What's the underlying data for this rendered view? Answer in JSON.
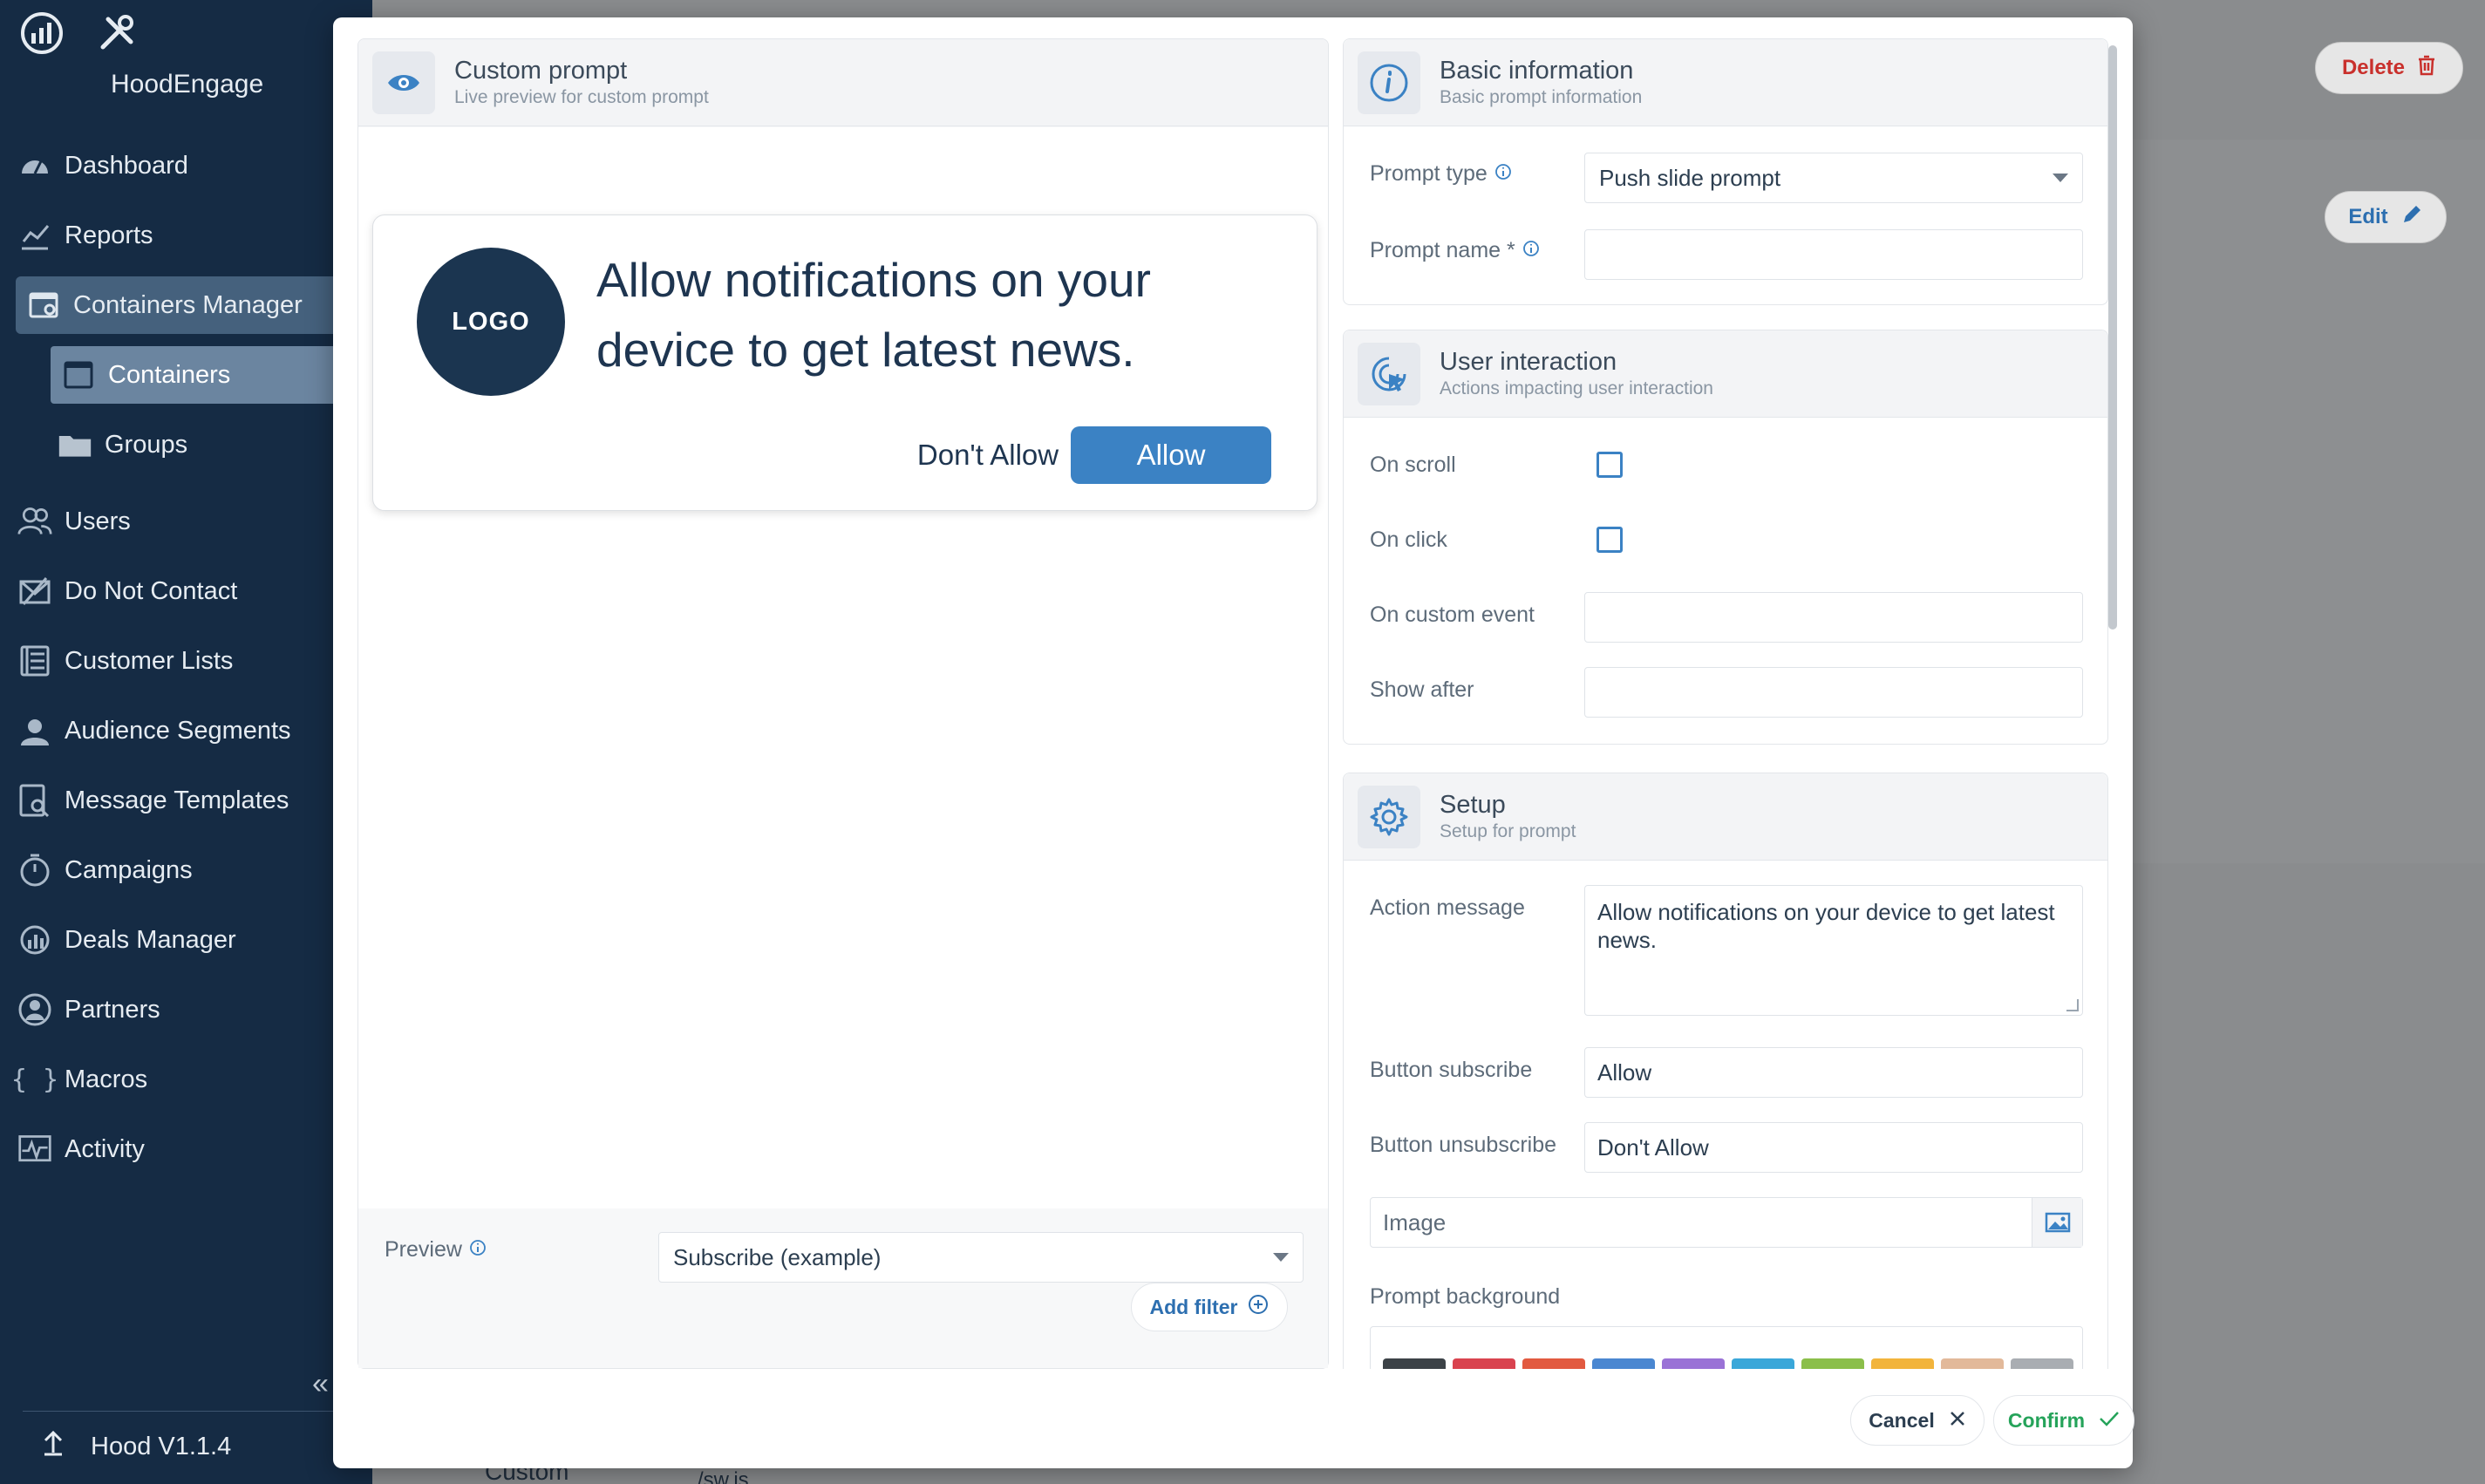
{
  "sidebar": {
    "brand": "HoodEngage",
    "items": [
      {
        "label": "Dashboard"
      },
      {
        "label": "Reports"
      },
      {
        "label": "Containers Manager"
      },
      {
        "label": "Containers"
      },
      {
        "label": "Groups"
      },
      {
        "label": "Users"
      },
      {
        "label": "Do Not Contact"
      },
      {
        "label": "Customer Lists"
      },
      {
        "label": "Audience Segments"
      },
      {
        "label": "Message Templates"
      },
      {
        "label": "Campaigns"
      },
      {
        "label": "Deals Manager"
      },
      {
        "label": "Partners"
      },
      {
        "label": "Macros"
      },
      {
        "label": "Activity"
      }
    ],
    "collapse": "«",
    "version": "Hood V1.1.4"
  },
  "background": {
    "delete_label": "Delete",
    "edit_label": "Edit",
    "footer_text": "Custom",
    "footer_text2": "/sw.js"
  },
  "custom_prompt": {
    "title": "Custom prompt",
    "subtitle": "Live preview for custom prompt",
    "logo": "LOGO",
    "message": "Allow notifications on your device to get latest news.",
    "dont_allow": "Don't Allow",
    "allow": "Allow",
    "preview_label": "Preview",
    "preview_value": "Subscribe (example)",
    "add_filter": "Add filter"
  },
  "basic_info": {
    "title": "Basic information",
    "subtitle": "Basic prompt information",
    "prompt_type_label": "Prompt type",
    "prompt_type_value": "Push slide prompt",
    "prompt_name_label": "Prompt name *",
    "prompt_name_value": ""
  },
  "user_interaction": {
    "title": "User interaction",
    "subtitle": "Actions impacting user interaction",
    "on_scroll": "On scroll",
    "on_click": "On click",
    "on_custom_event": "On custom event",
    "show_after": "Show after"
  },
  "setup": {
    "title": "Setup",
    "subtitle": "Setup for prompt",
    "action_message_label": "Action message",
    "action_message_value": "Allow notifications on your device to get latest news.",
    "button_subscribe_label": "Button subscribe",
    "button_subscribe_value": "Allow",
    "button_unsubscribe_label": "Button unsubscribe",
    "button_unsubscribe_value": "Don't Allow",
    "image_label": "Image",
    "prompt_background_label": "Prompt background",
    "swatch_colors": [
      "#3c4247",
      "#d9434f",
      "#e25a40",
      "#4a87d1",
      "#9a72d6",
      "#3aa7d9",
      "#8bbf4a",
      "#f2b43c",
      "#e2b99a",
      "#a9adb2"
    ]
  },
  "footer": {
    "cancel": "Cancel",
    "confirm": "Confirm"
  },
  "colors": {
    "sidebar_bg": "#152b44",
    "accent": "#3b82c4",
    "confirm": "#25a35a",
    "danger": "#c9302c"
  }
}
